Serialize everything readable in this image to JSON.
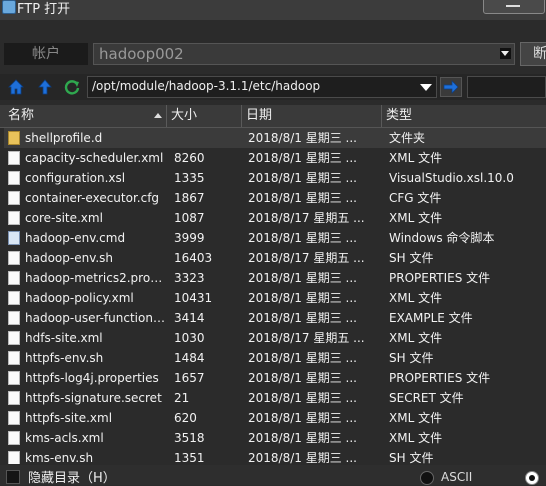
{
  "window": {
    "title": "FTP 打开"
  },
  "account": {
    "label": "帐户",
    "value": "hadoop002",
    "disconnect_label": "断"
  },
  "nav": {
    "path": "/opt/module/hadoop-3.1.1/etc/hadoop"
  },
  "columns": {
    "name": "名称",
    "size": "大小",
    "date": "日期",
    "type": "类型"
  },
  "files": [
    {
      "name": "shellprofile.d",
      "size": "",
      "date": "2018/8/1 星期三 ...",
      "type": "文件夹",
      "icon": "folder-icon"
    },
    {
      "name": "capacity-scheduler.xml",
      "size": "8260",
      "date": "2018/8/1 星期三 ...",
      "type": "XML 文件",
      "icon": "file-icon"
    },
    {
      "name": "configuration.xsl",
      "size": "1335",
      "date": "2018/8/1 星期三 ...",
      "type": "VisualStudio.xsl.10.0",
      "icon": "file-icon"
    },
    {
      "name": "container-executor.cfg",
      "size": "1867",
      "date": "2018/8/1 星期三 ...",
      "type": "CFG 文件",
      "icon": "file-icon"
    },
    {
      "name": "core-site.xml",
      "size": "1087",
      "date": "2018/8/17 星期五 ...",
      "type": "XML 文件",
      "icon": "file-icon"
    },
    {
      "name": "hadoop-env.cmd",
      "size": "3999",
      "date": "2018/8/1 星期三 ...",
      "type": "Windows 命令脚本",
      "icon": "cmd-icon"
    },
    {
      "name": "hadoop-env.sh",
      "size": "16403",
      "date": "2018/8/17 星期五 ...",
      "type": "SH 文件",
      "icon": "file-icon"
    },
    {
      "name": "hadoop-metrics2.prop...",
      "size": "3323",
      "date": "2018/8/1 星期三 ...",
      "type": "PROPERTIES 文件",
      "icon": "file-icon"
    },
    {
      "name": "hadoop-policy.xml",
      "size": "10431",
      "date": "2018/8/1 星期三 ...",
      "type": "XML 文件",
      "icon": "file-icon"
    },
    {
      "name": "hadoop-user-functions...",
      "size": "3414",
      "date": "2018/8/1 星期三 ...",
      "type": "EXAMPLE 文件",
      "icon": "file-icon"
    },
    {
      "name": "hdfs-site.xml",
      "size": "1030",
      "date": "2018/8/17 星期五 ...",
      "type": "XML 文件",
      "icon": "file-icon"
    },
    {
      "name": "httpfs-env.sh",
      "size": "1484",
      "date": "2018/8/1 星期三 ...",
      "type": "SH 文件",
      "icon": "file-icon"
    },
    {
      "name": "httpfs-log4j.properties",
      "size": "1657",
      "date": "2018/8/1 星期三 ...",
      "type": "PROPERTIES 文件",
      "icon": "file-icon"
    },
    {
      "name": "httpfs-signature.secret",
      "size": "21",
      "date": "2018/8/1 星期三 ...",
      "type": "SECRET 文件",
      "icon": "file-icon"
    },
    {
      "name": "httpfs-site.xml",
      "size": "620",
      "date": "2018/8/1 星期三 ...",
      "type": "XML 文件",
      "icon": "file-icon"
    },
    {
      "name": "kms-acls.xml",
      "size": "3518",
      "date": "2018/8/1 星期三 ...",
      "type": "XML 文件",
      "icon": "file-icon"
    },
    {
      "name": "kms-env.sh",
      "size": "1351",
      "date": "2018/8/1 星期三 ...",
      "type": "SH 文件",
      "icon": "file-icon"
    }
  ],
  "footer": {
    "hide_label": "隐藏目录（H）",
    "ascii_label": "ASCII"
  },
  "colors": {
    "background": "#2b2b2b",
    "accent": "#1e6fd9"
  }
}
